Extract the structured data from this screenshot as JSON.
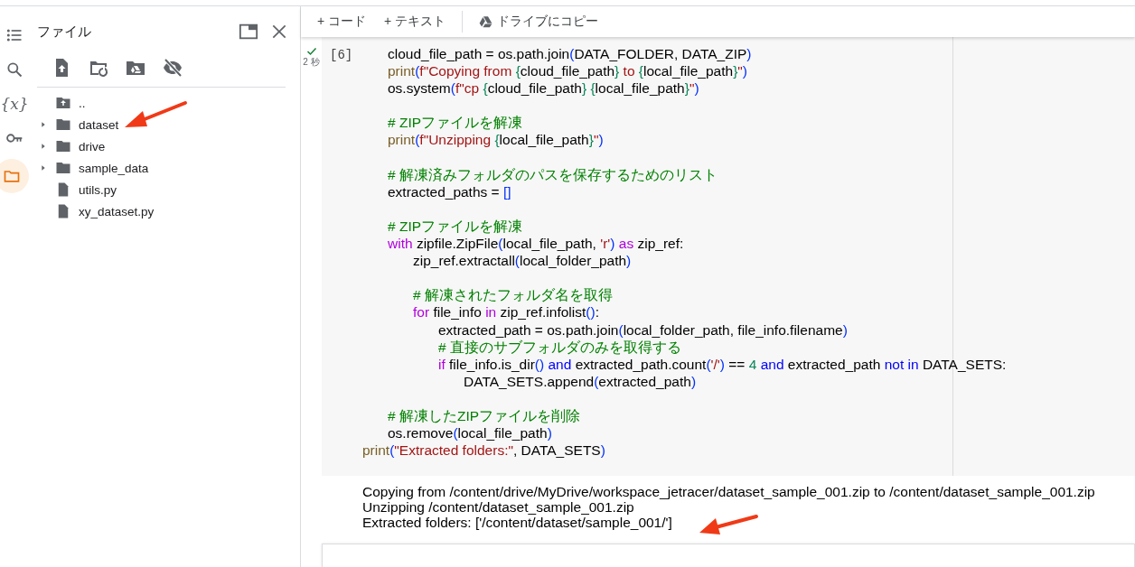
{
  "rail": [
    {
      "kind": "toc",
      "selected": false
    },
    {
      "kind": "search",
      "selected": false
    },
    {
      "kind": "variables",
      "label": "{x}",
      "selected": false
    },
    {
      "kind": "secrets",
      "selected": false
    },
    {
      "kind": "files",
      "selected": true
    }
  ],
  "file_panel": {
    "title": "ファイル",
    "tools": [
      {
        "kind": "upload"
      },
      {
        "kind": "refresh"
      },
      {
        "kind": "drive"
      },
      {
        "kind": "hide"
      }
    ],
    "items": [
      {
        "kind": "parent",
        "name": ".."
      },
      {
        "kind": "folder",
        "name": "dataset",
        "expanded": false
      },
      {
        "kind": "folder",
        "name": "drive",
        "expanded": false
      },
      {
        "kind": "folder",
        "name": "sample_data",
        "expanded": false
      },
      {
        "kind": "file",
        "name": "utils.py"
      },
      {
        "kind": "file",
        "name": "xy_dataset.py"
      }
    ]
  },
  "toolbar": [
    {
      "kind": "add",
      "label": "+ コード"
    },
    {
      "kind": "add",
      "label": "+ テキスト"
    },
    {
      "kind": "drive",
      "label": "ドライブにコピー"
    }
  ],
  "cell": {
    "done": true,
    "time": "2 秒",
    "prompt": "[6]",
    "lines": [
      {
        "kind": "code",
        "tokens": [
          {
            "kind": "plain",
            "text": "\tcloud_file_path = os.path.join"
          },
          {
            "kind": "br",
            "text": "("
          },
          {
            "kind": "plain",
            "text": "DATA_FOLDER, DATA_ZIP"
          },
          {
            "kind": "br",
            "text": ")"
          }
        ]
      },
      {
        "kind": "code",
        "tokens": [
          {
            "kind": "fn",
            "text": "\tprint"
          },
          {
            "kind": "br",
            "text": "("
          },
          {
            "kind": "str",
            "text": "f\"Copying from "
          },
          {
            "kind": "fb",
            "text": "{"
          },
          {
            "kind": "plain",
            "text": "cloud_file_path"
          },
          {
            "kind": "fb",
            "text": "}"
          },
          {
            "kind": "str",
            "text": " to "
          },
          {
            "kind": "fb",
            "text": "{"
          },
          {
            "kind": "plain",
            "text": "local_file_path"
          },
          {
            "kind": "fb",
            "text": "}"
          },
          {
            "kind": "str",
            "text": "\""
          },
          {
            "kind": "br",
            "text": ")"
          }
        ]
      },
      {
        "kind": "code",
        "tokens": [
          {
            "kind": "plain",
            "text": "\tos.system"
          },
          {
            "kind": "br",
            "text": "("
          },
          {
            "kind": "str",
            "text": "f\"cp "
          },
          {
            "kind": "fb",
            "text": "{"
          },
          {
            "kind": "plain",
            "text": "cloud_file_path"
          },
          {
            "kind": "fb",
            "text": "} {"
          },
          {
            "kind": "plain",
            "text": "local_file_path"
          },
          {
            "kind": "fb",
            "text": "}"
          },
          {
            "kind": "str",
            "text": "\""
          },
          {
            "kind": "br",
            "text": ")"
          }
        ]
      },
      {
        "kind": "blank"
      },
      {
        "kind": "code",
        "tokens": [
          {
            "kind": "cm",
            "text": "\t# ZIPファイルを解凍"
          }
        ]
      },
      {
        "kind": "code",
        "tokens": [
          {
            "kind": "fn",
            "text": "\tprint"
          },
          {
            "kind": "br",
            "text": "("
          },
          {
            "kind": "str",
            "text": "f\"Unzipping "
          },
          {
            "kind": "fb",
            "text": "{"
          },
          {
            "kind": "plain",
            "text": "local_file_path"
          },
          {
            "kind": "fb",
            "text": "}"
          },
          {
            "kind": "str",
            "text": "\""
          },
          {
            "kind": "br",
            "text": ")"
          }
        ]
      },
      {
        "kind": "blank"
      },
      {
        "kind": "code",
        "tokens": [
          {
            "kind": "cm",
            "text": "\t# 解凍済みフォルダのパスを保存するためのリスト"
          }
        ]
      },
      {
        "kind": "code",
        "tokens": [
          {
            "kind": "plain",
            "text": "\textracted_paths = "
          },
          {
            "kind": "br",
            "text": "[]"
          }
        ]
      },
      {
        "kind": "blank"
      },
      {
        "kind": "code",
        "tokens": [
          {
            "kind": "cm",
            "text": "\t# ZIPファイルを解凍"
          }
        ]
      },
      {
        "kind": "code",
        "tokens": [
          {
            "kind": "kw",
            "text": "\twith"
          },
          {
            "kind": "plain",
            "text": " zipfile.ZipFile"
          },
          {
            "kind": "br",
            "text": "("
          },
          {
            "kind": "plain",
            "text": "local_file_path, "
          },
          {
            "kind": "str",
            "text": "'r'"
          },
          {
            "kind": "br",
            "text": ") "
          },
          {
            "kind": "kw",
            "text": "as"
          },
          {
            "kind": "plain",
            "text": " zip_ref:"
          }
        ]
      },
      {
        "kind": "code",
        "tokens": [
          {
            "kind": "plain",
            "text": "\t\tzip_ref.extractall"
          },
          {
            "kind": "br",
            "text": "("
          },
          {
            "kind": "plain",
            "text": "local_folder_path"
          },
          {
            "kind": "br",
            "text": ")"
          }
        ]
      },
      {
        "kind": "blank"
      },
      {
        "kind": "code",
        "tokens": [
          {
            "kind": "cm",
            "text": "\t\t# 解凍されたフォルダ名を取得"
          }
        ]
      },
      {
        "kind": "code",
        "tokens": [
          {
            "kind": "kw",
            "text": "\t\tfor"
          },
          {
            "kind": "plain",
            "text": " file_info "
          },
          {
            "kind": "kw",
            "text": "in"
          },
          {
            "kind": "plain",
            "text": " zip_ref.infolist"
          },
          {
            "kind": "br",
            "text": "()"
          },
          {
            "kind": "plain",
            "text": ":"
          }
        ]
      },
      {
        "kind": "code",
        "tokens": [
          {
            "kind": "plain",
            "text": "\t\t\textracted_path = os.path.join"
          },
          {
            "kind": "br",
            "text": "("
          },
          {
            "kind": "plain",
            "text": "local_folder_path, file_info.filename"
          },
          {
            "kind": "br",
            "text": ")"
          }
        ]
      },
      {
        "kind": "code",
        "tokens": [
          {
            "kind": "cm",
            "text": "\t\t\t# 直接のサブフォルダのみを取得する"
          }
        ]
      },
      {
        "kind": "code",
        "tokens": [
          {
            "kind": "kw",
            "text": "\t\t\tif"
          },
          {
            "kind": "plain",
            "text": " file_info.is_dir"
          },
          {
            "kind": "br",
            "text": "() "
          },
          {
            "kind": "op",
            "text": "and"
          },
          {
            "kind": "plain",
            "text": " extracted_path.count"
          },
          {
            "kind": "br",
            "text": "("
          },
          {
            "kind": "str",
            "text": "'/'"
          },
          {
            "kind": "br",
            "text": ")"
          },
          {
            "kind": "plain",
            "text": " == "
          },
          {
            "kind": "num",
            "text": "4"
          },
          {
            "kind": "op",
            "text": " and"
          },
          {
            "kind": "plain",
            "text": " extracted_path "
          },
          {
            "kind": "op",
            "text": "not in"
          },
          {
            "kind": "plain",
            "text": " DATA_SETS:"
          }
        ]
      },
      {
        "kind": "code",
        "tokens": [
          {
            "kind": "plain",
            "text": "\t\t\t\tDATA_SETS.append"
          },
          {
            "kind": "br",
            "text": "("
          },
          {
            "kind": "plain",
            "text": "extracted_path"
          },
          {
            "kind": "br",
            "text": ")"
          }
        ]
      },
      {
        "kind": "blank"
      },
      {
        "kind": "code",
        "tokens": [
          {
            "kind": "cm",
            "text": "\t# 解凍したZIPファイルを削除"
          }
        ]
      },
      {
        "kind": "code",
        "tokens": [
          {
            "kind": "plain",
            "text": "\tos.remove"
          },
          {
            "kind": "br",
            "text": "("
          },
          {
            "kind": "plain",
            "text": "local_file_path"
          },
          {
            "kind": "br",
            "text": ")"
          }
        ]
      },
      {
        "kind": "code",
        "tokens": [
          {
            "kind": "fn",
            "text": "print"
          },
          {
            "kind": "br",
            "text": "("
          },
          {
            "kind": "str",
            "text": "\"Extracted folders:\""
          },
          {
            "kind": "plain",
            "text": ", DATA_SETS"
          },
          {
            "kind": "br",
            "text": ")"
          }
        ]
      }
    ],
    "output": [
      "Copying from /content/drive/MyDrive/workspace_jetracer/dataset_sample_001.zip to /content/dataset_sample_001.zip",
      "Unzipping /content/dataset_sample_001.zip",
      "Extracted folders: ['/content/dataset/sample_001/']"
    ]
  }
}
